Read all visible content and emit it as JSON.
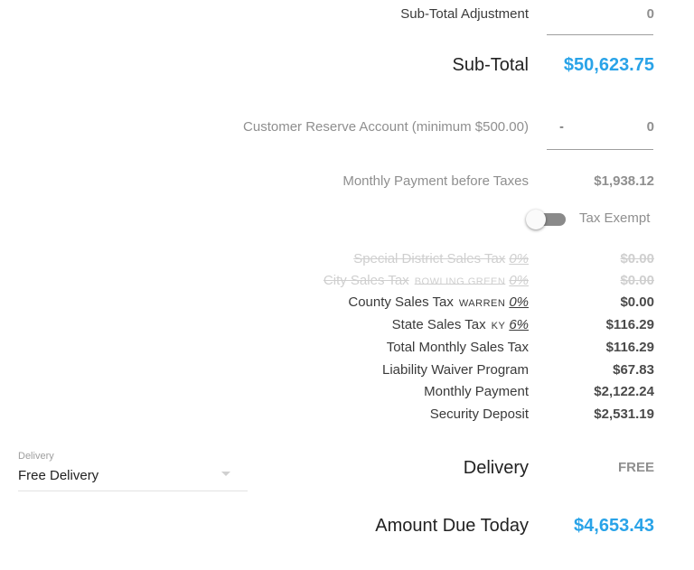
{
  "subtotal_adjustment": {
    "label": "Sub-Total Adjustment",
    "value": "0"
  },
  "subtotal": {
    "label": "Sub-Total",
    "value": "$50,623.75"
  },
  "reserve": {
    "label": "Customer Reserve Account (minimum $500.00)",
    "prefix": "-",
    "value": "0"
  },
  "monthly_before_taxes": {
    "label": "Monthly Payment before Taxes",
    "value": "$1,938.12"
  },
  "tax_exempt": {
    "label": "Tax Exempt",
    "enabled": false
  },
  "taxes": [
    {
      "label": "Special District Sales Tax",
      "sub": "",
      "rate": "0%",
      "value": "$0.00",
      "struck": true
    },
    {
      "label": "City Sales Tax",
      "sub": "BOWLING GREEN",
      "rate": "0%",
      "value": "$0.00",
      "struck": true
    },
    {
      "label": "County Sales Tax",
      "sub": "WARREN",
      "rate": "0%",
      "value": "$0.00",
      "struck": false
    },
    {
      "label": "State Sales Tax",
      "sub": "KY",
      "rate": "6%",
      "value": "$116.29",
      "struck": false
    }
  ],
  "summary": [
    {
      "label": "Total Monthly Sales Tax",
      "value": "$116.29"
    },
    {
      "label": "Liability Waiver Program",
      "value": "$67.83"
    },
    {
      "label": "Monthly Payment",
      "value": "$2,122.24"
    },
    {
      "label": "Security Deposit",
      "value": "$2,531.19"
    }
  ],
  "delivery_select": {
    "label": "Delivery",
    "value": "Free Delivery"
  },
  "delivery": {
    "label": "Delivery",
    "value": "FREE"
  },
  "amount_due": {
    "label": "Amount Due Today",
    "value": "$4,653.43"
  },
  "colors": {
    "accent": "#29a3e8",
    "grey": "#8f8f8f"
  }
}
